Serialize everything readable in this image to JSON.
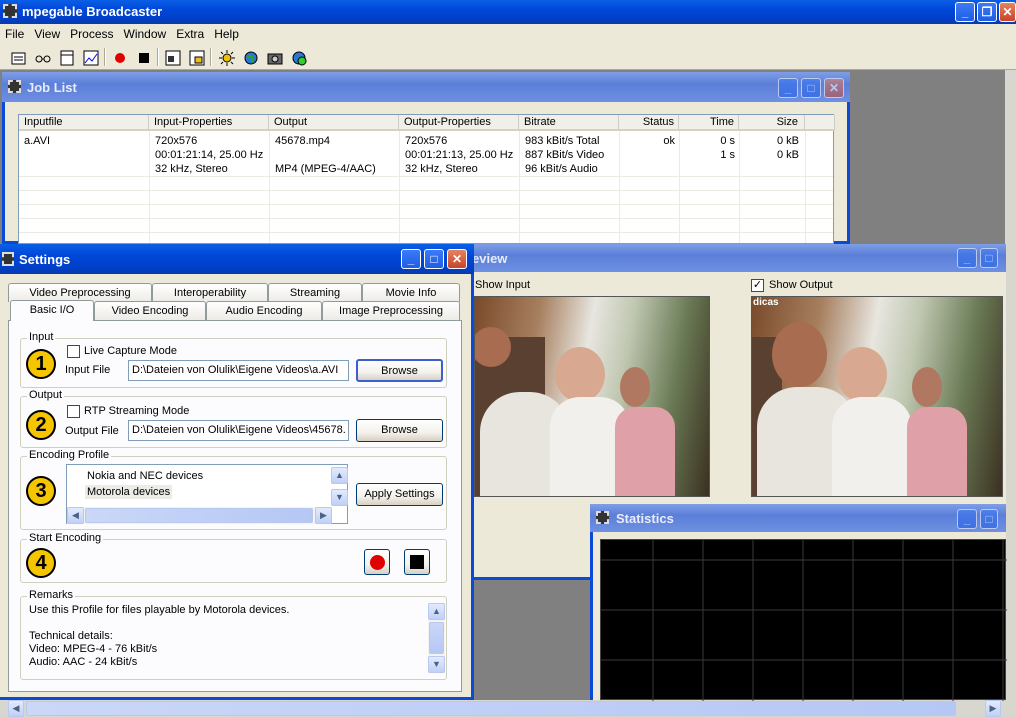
{
  "app": {
    "title": "mpegable Broadcaster"
  },
  "menu": [
    "File",
    "View",
    "Process",
    "Window",
    "Extra",
    "Help"
  ],
  "toolbar_icons": [
    "properties-icon",
    "glasses-icon",
    "frame-icon",
    "chart-icon",
    "record-icon",
    "stop-icon",
    "window-tile-icon",
    "window-save-icon",
    "sun-icon",
    "globe-icon",
    "camera-icon",
    "network-icon"
  ],
  "joblist": {
    "title": "Job List",
    "columns": [
      "Inputfile",
      "Input-Properties",
      "Output",
      "Output-Properties",
      "Bitrate",
      "Status",
      "Time",
      "Size"
    ],
    "row": {
      "inputfile": "a.AVI",
      "input_props": [
        "720x576",
        "00:01:21:14, 25.00 Hz",
        "32 kHz, Stereo"
      ],
      "output": [
        "45678.mp4",
        "",
        "MP4 (MPEG-4/AAC)"
      ],
      "output_props": [
        "720x576",
        "00:01:21:13, 25.00 Hz",
        "32 kHz, Stereo"
      ],
      "bitrate": [
        "983 kBit/s Total",
        "887 kBit/s Video",
        "96 kBit/s Audio"
      ],
      "status": "ok",
      "time": [
        "0 s",
        "1 s"
      ],
      "size": [
        "0 kB",
        "0 kB"
      ]
    }
  },
  "preview": {
    "title": "eview",
    "show_input": "Show Input",
    "show_output": "Show Output",
    "overlay": "dicas"
  },
  "statistics": {
    "title": "Statistics"
  },
  "settings": {
    "title": "Settings",
    "tabs_back": [
      "Video Preprocessing",
      "Interoperability",
      "Streaming",
      "Movie Info"
    ],
    "tabs_front": [
      "Basic I/O",
      "Video Encoding",
      "Audio Encoding",
      "Image Preprocessing"
    ],
    "input": {
      "label": "Input",
      "step": "1",
      "live": "Live Capture Mode",
      "file_label": "Input File",
      "file_value": "D:\\Dateien von Olulik\\Eigene Videos\\a.AVI",
      "browse": "Browse"
    },
    "output": {
      "label": "Output",
      "step": "2",
      "rtp": "RTP Streaming Mode",
      "file_label": "Output File",
      "file_value": "D:\\Dateien von Olulik\\Eigene Videos\\45678.",
      "browse": "Browse"
    },
    "profile": {
      "label": "Encoding Profile",
      "step": "3",
      "items": [
        "Nokia and NEC devices",
        "Motorola devices"
      ],
      "apply": "Apply Settings"
    },
    "start": {
      "label": "Start Encoding",
      "step": "4"
    },
    "remarks": {
      "label": "Remarks",
      "lines": [
        "Use this Profile for files playable by Motorola devices.",
        "",
        "Technical details:",
        "Video: MPEG-4 - 76 kBit/s",
        "Audio: AAC - 24 kBit/s"
      ]
    }
  }
}
